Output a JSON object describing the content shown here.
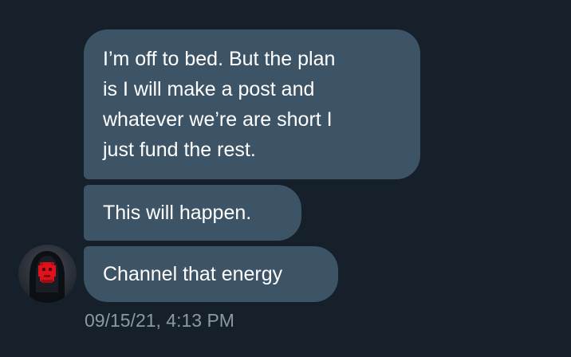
{
  "messages": [
    {
      "text": "I’m off to bed. But the plan\nis I will make a post and\nwhatever we’re are short I\njust fund the rest."
    },
    {
      "text": "This will happen."
    },
    {
      "text": "Channel that energy"
    }
  ],
  "timestamp": "09/15/21, 4:13 PM",
  "sender": {
    "avatar_icon": "hooded-figure-red-face-avatar"
  },
  "colors": {
    "background": "#15202b",
    "bubble": "#3d5466",
    "text": "#ffffff",
    "timestamp": "#8b98a5",
    "avatar_face": "#e0121b"
  }
}
